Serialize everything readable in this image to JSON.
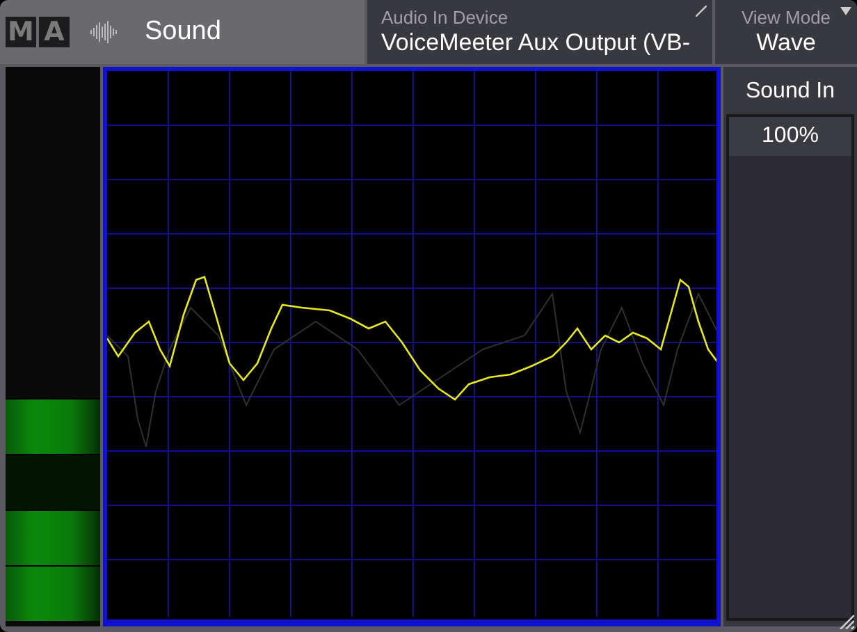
{
  "window": {
    "logo": [
      "M",
      "A"
    ],
    "title": "Sound"
  },
  "audio_in_device": {
    "label": "Audio In Device",
    "value": "VoiceMeeter Aux Output (VB-"
  },
  "view_mode": {
    "label": "View Mode",
    "value": "Wave"
  },
  "meter": {
    "segments": [
      {
        "on": true
      },
      {
        "on": false
      },
      {
        "on": true
      },
      {
        "on": true
      }
    ]
  },
  "sound_in": {
    "label": "Sound In",
    "value": "100%"
  }
}
